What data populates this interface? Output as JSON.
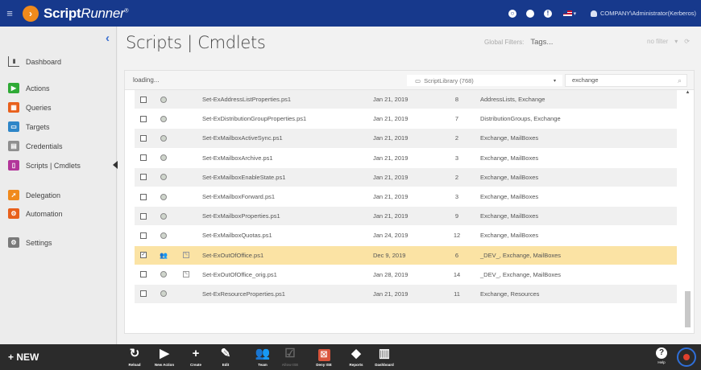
{
  "app": {
    "menu_glyph": "≡",
    "logo_glyph": "›",
    "brand_bold": "Script",
    "brand_light": "Runner",
    "brand_mark": "®"
  },
  "topbar": {
    "icons": [
      "info-circle-icon",
      "notification-dot-icon",
      "alert-icon",
      "flag-icon"
    ],
    "user": "COMPANY\\Administrator(Kerberos)"
  },
  "sidebar": {
    "collapse_glyph": "‹",
    "items": [
      {
        "label": "Dashboard",
        "icon": "dashboard-icon",
        "color": "#ffffff"
      },
      {
        "label": "Actions",
        "icon": "actions-icon",
        "color": "#2faa36"
      },
      {
        "label": "Queries",
        "icon": "queries-icon",
        "color": "#e8601c"
      },
      {
        "label": "Targets",
        "icon": "targets-icon",
        "color": "#2e86c8"
      },
      {
        "label": "Credentials",
        "icon": "credentials-icon",
        "color": "#8f8f8f"
      },
      {
        "label": "Scripts | Cmdlets",
        "icon": "scripts-icon",
        "color": "#b2359a"
      },
      {
        "label": "Delegation",
        "icon": "delegation-icon",
        "color": "#f08a1c"
      },
      {
        "label": "Automation",
        "icon": "automation-icon",
        "color": "#e8601c"
      },
      {
        "label": "Settings",
        "icon": "settings-icon",
        "color": "#7a7a7a"
      }
    ]
  },
  "header": {
    "title": "Scripts | Cmdlets",
    "global_filters_label": "Global Filters:",
    "tags_placeholder": "Tags...",
    "no_filter": "no filter",
    "no_filter_caret": "▾",
    "refresh_glyph": "⟳"
  },
  "toolbar": {
    "status": "loading...",
    "library_icon": "folder-icon",
    "library": "ScriptLibrary (768)",
    "library_caret": "▾",
    "search_value": "exchange",
    "search_icon": "⌕",
    "scroll_up": "▲"
  },
  "rows": [
    {
      "name": "Set-ExAddressListProperties.ps1",
      "date": "Jan 21, 2019",
      "count": "8",
      "tags": "AddressLists, Exchange",
      "checked": false,
      "team": false,
      "edit": false
    },
    {
      "name": "Set-ExDistributionGroupProperties.ps1",
      "date": "Jan 21, 2019",
      "count": "7",
      "tags": "DistributionGroups, Exchange",
      "checked": false,
      "team": false,
      "edit": false
    },
    {
      "name": "Set-ExMailboxActiveSync.ps1",
      "date": "Jan 21, 2019",
      "count": "2",
      "tags": "Exchange, MailBoxes",
      "checked": false,
      "team": false,
      "edit": false
    },
    {
      "name": "Set-ExMailboxArchive.ps1",
      "date": "Jan 21, 2019",
      "count": "3",
      "tags": "Exchange, MailBoxes",
      "checked": false,
      "team": false,
      "edit": false
    },
    {
      "name": "Set-ExMailboxEnableState.ps1",
      "date": "Jan 21, 2019",
      "count": "2",
      "tags": "Exchange, MailBoxes",
      "checked": false,
      "team": false,
      "edit": false
    },
    {
      "name": "Set-ExMailboxForward.ps1",
      "date": "Jan 21, 2019",
      "count": "3",
      "tags": "Exchange, MailBoxes",
      "checked": false,
      "team": false,
      "edit": false
    },
    {
      "name": "Set-ExMailboxProperties.ps1",
      "date": "Jan 21, 2019",
      "count": "9",
      "tags": "Exchange, MailBoxes",
      "checked": false,
      "team": false,
      "edit": false
    },
    {
      "name": "Set-ExMailboxQuotas.ps1",
      "date": "Jan 24, 2019",
      "count": "12",
      "tags": "Exchange, MailBoxes",
      "checked": false,
      "team": false,
      "edit": false
    },
    {
      "name": "Set-ExOutOfOffice.ps1",
      "date": "Dec 9, 2019",
      "count": "6",
      "tags": "_DEV_, Exchange, MailBoxes",
      "checked": true,
      "team": true,
      "edit": true
    },
    {
      "name": "Set-ExOutOfOffice_orig.ps1",
      "date": "Jan 28, 2019",
      "count": "14",
      "tags": "_DEV_, Exchange, MailBoxes",
      "checked": false,
      "team": false,
      "edit": true
    },
    {
      "name": "Set-ExResourceProperties.ps1",
      "date": "Jan 21, 2019",
      "count": "11",
      "tags": "Exchange, Resources",
      "checked": false,
      "team": false,
      "edit": false
    }
  ],
  "bottombar": {
    "new_label": "+ NEW",
    "tools": [
      {
        "label": "Reload",
        "icon": "reload-icon",
        "glyph": "↻",
        "enabled": true
      },
      {
        "label": "New Action",
        "icon": "new-action-icon",
        "glyph": "▶",
        "enabled": true
      },
      {
        "label": "Create",
        "icon": "create-icon",
        "glyph": "+",
        "enabled": true
      },
      {
        "label": "Edit",
        "icon": "edit-icon",
        "glyph": "✎",
        "enabled": true
      },
      {
        "label": "Team",
        "icon": "team-icon",
        "glyph": "👥",
        "enabled": true
      },
      {
        "label": "Allow ISE",
        "icon": "allow-ise-icon",
        "glyph": "☑",
        "enabled": false
      },
      {
        "label": "Deny ISE",
        "icon": "deny-ise-icon",
        "glyph": "☒",
        "enabled": true
      },
      {
        "label": "Reports",
        "icon": "reports-icon",
        "glyph": "◆",
        "enabled": true
      },
      {
        "label": "Dashboard",
        "icon": "dashboard-icon",
        "glyph": "▥",
        "enabled": true
      }
    ],
    "help_label": "Help",
    "help_glyph": "?"
  }
}
